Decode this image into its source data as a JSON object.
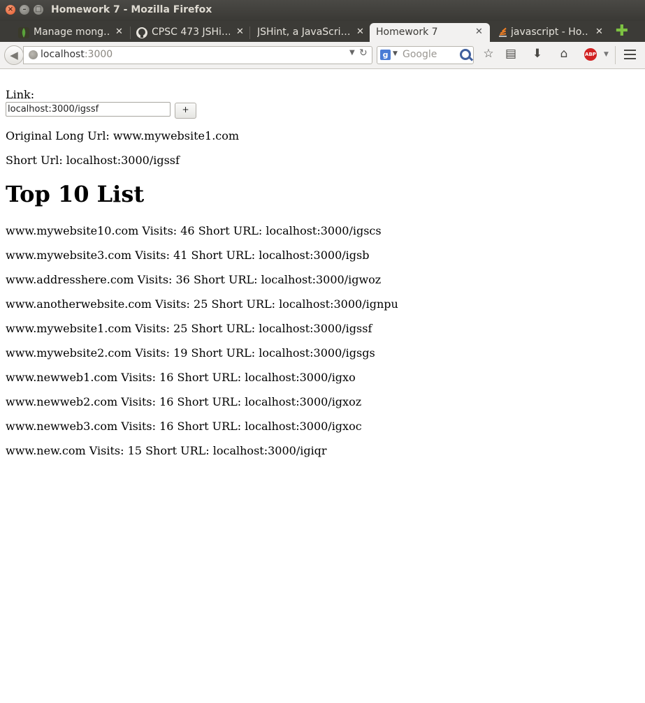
{
  "window": {
    "title": "Homework 7 - Mozilla Firefox"
  },
  "tabs": [
    {
      "label": "Manage mong…",
      "icon": "mongodb-leaf-icon"
    },
    {
      "label": "CPSC 473 JSHi…",
      "icon": "github-icon"
    },
    {
      "label": "JSHint, a JavaScri…",
      "icon": ""
    },
    {
      "label": "Homework 7",
      "icon": "",
      "active": true
    },
    {
      "label": "javascript - Ho…",
      "icon": "stackoverflow-icon"
    }
  ],
  "nav": {
    "url_host": "localhost",
    "url_rest": ":3000",
    "search_placeholder": "Google"
  },
  "page": {
    "link_label": "Link:",
    "link_input_value": "localhost:3000/igssf",
    "add_button_label": "+",
    "original_url_line": "Original Long Url: www.mywebsite1.com",
    "short_url_line": "Short Url: localhost:3000/igssf",
    "heading": "Top 10 List",
    "list": [
      "www.mywebsite10.com Visits: 46 Short URL: localhost:3000/igscs",
      "www.mywebsite3.com Visits: 41 Short URL: localhost:3000/igsb",
      "www.addresshere.com Visits: 36 Short URL: localhost:3000/igwoz",
      "www.anotherwebsite.com Visits: 25 Short URL: localhost:3000/ignpu",
      "www.mywebsite1.com Visits: 25 Short URL: localhost:3000/igssf",
      "www.mywebsite2.com Visits: 19 Short URL: localhost:3000/igsgs",
      "www.newweb1.com Visits: 16 Short URL: localhost:3000/igxo",
      "www.newweb2.com Visits: 16 Short URL: localhost:3000/igxoz",
      "www.newweb3.com Visits: 16 Short URL: localhost:3000/igxoc",
      "www.new.com Visits: 15 Short URL: localhost:3000/igiqr"
    ]
  }
}
